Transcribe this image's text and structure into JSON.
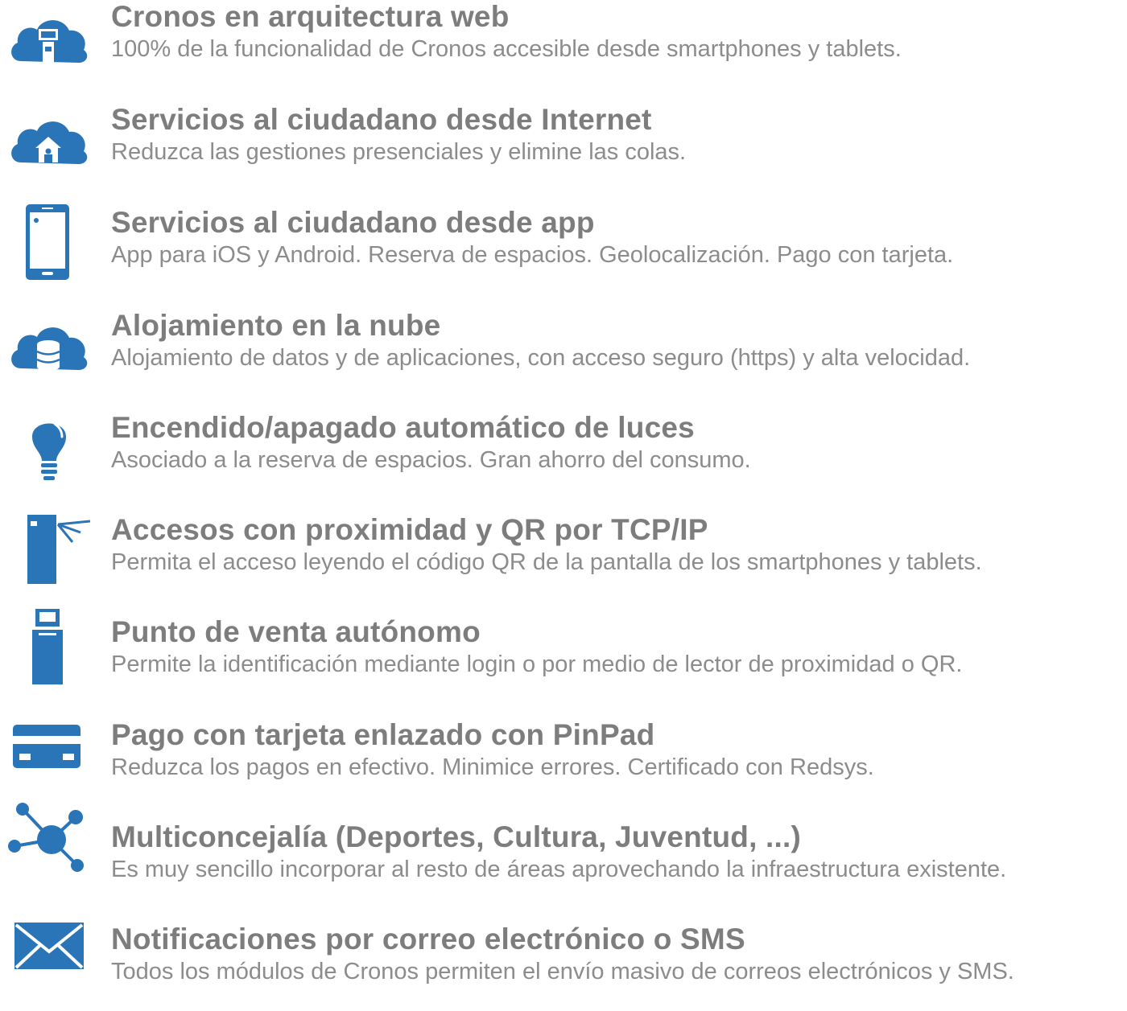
{
  "brand_color": "#2a74b8",
  "features": [
    {
      "icon": "cloud-web-icon",
      "title": "Cronos en arquitectura web",
      "description": "100% de la funcionalidad de Cronos accesible desde smartphones y tablets."
    },
    {
      "icon": "cloud-home-icon",
      "title": "Servicios al ciudadano desde Internet",
      "description": "Reduzca las gestiones presenciales y elimine las colas."
    },
    {
      "icon": "smartphone-icon",
      "title": "Servicios al ciudadano desde app",
      "description": "App para iOS y Android. Reserva de espacios. Geolocalización. Pago con tarjeta."
    },
    {
      "icon": "cloud-database-icon",
      "title": "Alojamiento en la nube",
      "description": "Alojamiento de datos y de aplicaciones, con acceso seguro (https) y alta velocidad."
    },
    {
      "icon": "lightbulb-icon",
      "title": "Encendido/apagado automático de luces",
      "description": "Asociado a la reserva de espacios. Gran ahorro del consumo."
    },
    {
      "icon": "turnstile-icon",
      "title": "Accesos con proximidad y QR por TCP/IP",
      "description": "Permita el acceso leyendo el código QR de la pantalla de los smartphones y tablets."
    },
    {
      "icon": "kiosk-icon",
      "title": "Punto de venta autónomo",
      "description": "Permite la identificación mediante login o por medio de lector de proximidad o QR."
    },
    {
      "icon": "credit-card-icon",
      "title": "Pago con tarjeta enlazado con PinPad",
      "description": "Reduzca los pagos en efectivo. Minimice errores. Certificado con Redsys."
    },
    {
      "icon": "network-hub-icon",
      "title": "Multiconcejalía (Deportes, Cultura, Juventud, ...)",
      "description": "Es muy sencillo incorporar al resto de áreas aprovechando la infraestructura existente."
    },
    {
      "icon": "envelope-icon",
      "title": "Notificaciones por correo electrónico o SMS",
      "description": "Todos los módulos de Cronos permiten el envío masivo de correos electrónicos y SMS."
    }
  ]
}
